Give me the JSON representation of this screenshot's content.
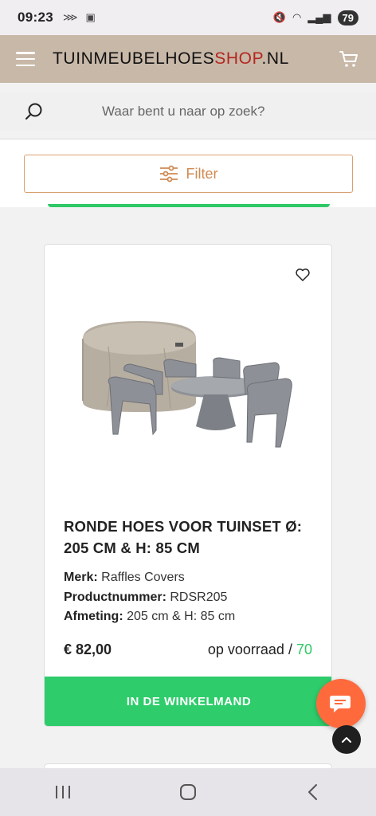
{
  "status": {
    "time": "09:23",
    "battery": "79"
  },
  "header": {
    "logo_main": "TUINMEUBELHOES",
    "logo_accent": "SHOP",
    "logo_tail": ".NL"
  },
  "search": {
    "placeholder": "Waar bent u naar op zoek?"
  },
  "filter": {
    "label": "Filter"
  },
  "product": {
    "title": "RONDE HOES VOOR TUINSET Ø: 205 CM & H: 85 CM",
    "brand_label": "Merk:",
    "brand": "Raffles Covers",
    "sku_label": "Productnummer:",
    "sku": "RDSR205",
    "size_label": "Afmeting:",
    "size": "205 cm & H: 85 cm",
    "price": "€ 82,00",
    "stock_label": "op voorraad /",
    "stock_count": "70",
    "add_to_cart": "IN DE WINKELMAND"
  },
  "colors": {
    "header_bg": "#c8b8a8",
    "accent_orange": "#d08a52",
    "green": "#2ecc6b",
    "chat_orange": "#ff6a3d",
    "logo_red": "#b3261e"
  },
  "icons": [
    "hamburger-icon",
    "cart-icon",
    "search-icon",
    "filter-sliders-icon",
    "heart-icon",
    "chat-icon",
    "arrow-up-icon",
    "recents-icon",
    "home-icon",
    "back-icon"
  ]
}
